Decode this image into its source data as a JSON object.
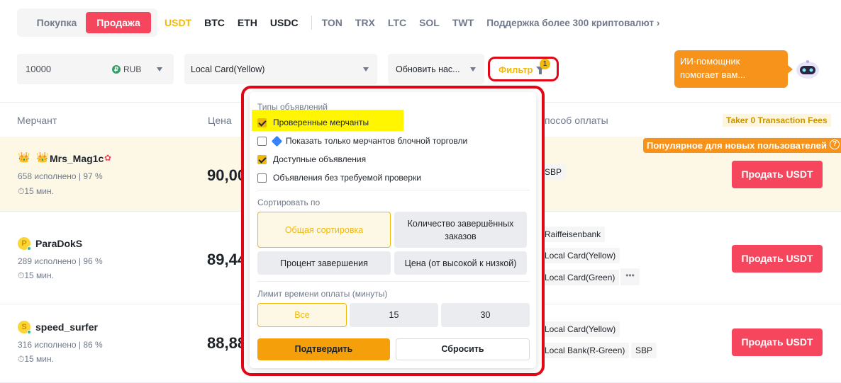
{
  "trade_toggle": {
    "buy": "Покупка",
    "sell": "Продажа"
  },
  "coins": {
    "usdt": "USDT",
    "btc": "BTC",
    "eth": "ETH",
    "usdc": "USDC",
    "ton": "TON",
    "trx": "TRX",
    "ltc": "LTC",
    "sol": "SOL",
    "twt": "TWT"
  },
  "support_link": "Поддержка более 300 криптовалют",
  "amount": {
    "value": "10000",
    "currency": "RUB",
    "currency_icon": "₽"
  },
  "payment_select": "Local Card(Yellow)",
  "refresh_select": "Обновить нас...",
  "filter": {
    "label": "Фильтр",
    "badge": "1"
  },
  "ai_helper": {
    "line1": "ИИ-помощник",
    "line2": "помогает вам..."
  },
  "table_headers": {
    "merchant": "Мерчант",
    "price": "Цена",
    "payment": "пособ оплаты",
    "taker": "Taker 0 Transaction Fees"
  },
  "popular_badge": "Популярное для новых пользователей",
  "rows": [
    {
      "name": "Mrs_Mag1c",
      "stats": "658 исполнено  |  97 %",
      "time": "15 мин.",
      "price": "90,00",
      "tags": [
        "SBP"
      ],
      "action": "Продать USDT"
    },
    {
      "avatar": "P",
      "name": "ParaDokS",
      "stats": "289 исполнено  |  96 %",
      "time": "15 мин.",
      "price": "89,44",
      "tags": [
        "Raiffeisenbank",
        "Local Card(Yellow)",
        "Local Card(Green)"
      ],
      "more": "•••",
      "action": "Продать USDT"
    },
    {
      "avatar": "S",
      "name": "speed_surfer",
      "stats": "316 исполнено  |  86 %",
      "time": "15 мин.",
      "price": "88,88",
      "tags": [
        "Local Card(Yellow)",
        "Local Bank(R-Green)",
        "SBP"
      ],
      "action": "Продать USDT"
    }
  ],
  "panel": {
    "ad_types_title": "Типы объявлений",
    "checkboxes": [
      {
        "label": "Проверенные мерчанты",
        "checked": true
      },
      {
        "label": "Показать только мерчантов блочной торговли",
        "checked": false
      },
      {
        "label": "Доступные объявления",
        "checked": true
      },
      {
        "label": "Объявления без требуемой проверки",
        "checked": false
      }
    ],
    "sort_title": "Сортировать по",
    "sort_options": [
      "Общая сортировка",
      "Количество завершённых заказов",
      "Процент завершения",
      "Цена (от высокой к низкой)"
    ],
    "time_title": "Лимит времени оплаты (минуты)",
    "time_options": [
      "Все",
      "15",
      "30"
    ],
    "confirm": "Подтвердить",
    "reset": "Сбросить"
  },
  "colors": {
    "accent": "#f0b90b",
    "sell": "#f6465d",
    "highlight_border": "#e10714",
    "ai_bubble": "#f7931a"
  }
}
